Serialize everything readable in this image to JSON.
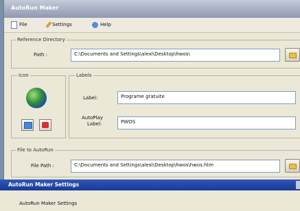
{
  "window": {
    "title": "AutoRun Maker"
  },
  "menu": [
    {
      "label": "File",
      "icon": "document-icon"
    },
    {
      "label": "Settings",
      "icon": "wrench-icon"
    },
    {
      "label": "Help",
      "icon": "help-icon"
    }
  ],
  "reference": {
    "legend": "Reference Directory",
    "path_label": "Path :",
    "path_value": "C:\\Documents and Settings\\alexi\\Desktop\\hwos\\"
  },
  "icon_group": {
    "legend": "Icon"
  },
  "labels": {
    "legend": "Labels",
    "label_caption": "Label:",
    "label_value": "Programe gratuite",
    "autoplay_caption_1": "AutoPlay",
    "autoplay_caption_2": "Label:",
    "autoplay_value": "PWOS"
  },
  "file_to_autorun": {
    "legend": "File to AutoRun",
    "path_label": "File Path :",
    "path_value": "C:\\Documents and Settings\\alexi\\Desktop\\hwos\\hwos.htm"
  },
  "settings_window": {
    "title": "AutoRun Maker Settings",
    "group_legend": "AutoRun Maker Settings"
  },
  "colors": {
    "accent": "#1a3a96",
    "window_bg": "#ece8d8",
    "field_border": "#7f9db9"
  }
}
